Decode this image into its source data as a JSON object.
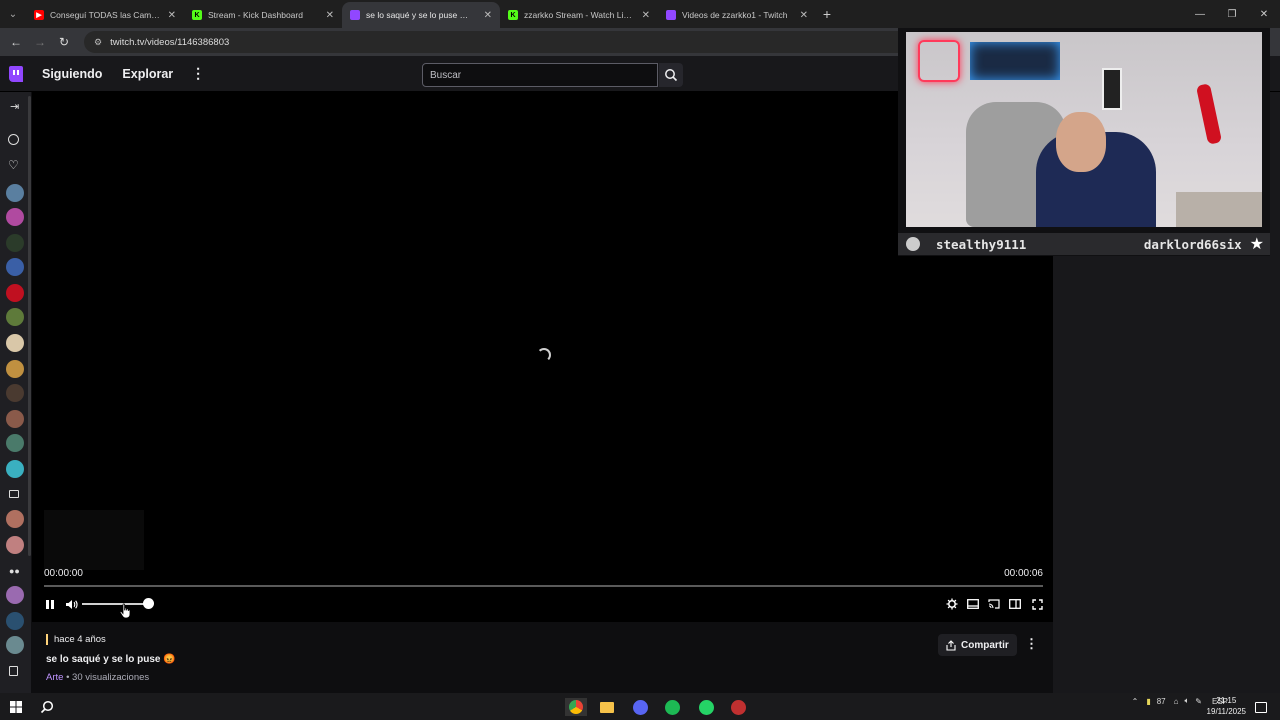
{
  "browser": {
    "tabs": [
      {
        "title": "Conseguí TODAS las Camisetas",
        "favicon": "youtube-icon",
        "color": "#ff0000",
        "active": false
      },
      {
        "title": "Stream - Kick Dashboard",
        "favicon": "kick-icon",
        "color": "#53fc18",
        "active": false
      },
      {
        "title": "se lo saqué y se lo puse 😡 - Twitch",
        "favicon": "twitch-icon",
        "color": "#9147ff",
        "active": true
      },
      {
        "title": "zzarkko Stream - Watch Live on Kick",
        "favicon": "kick-icon",
        "color": "#53fc18",
        "active": false
      },
      {
        "title": "Videos de zzarkko1 - Twitch",
        "favicon": "twitch-icon",
        "color": "#9147ff",
        "active": false
      }
    ],
    "url": "twitch.tv/videos/1146386803"
  },
  "twitch_nav": {
    "following": "Siguiendo",
    "explore": "Explorar",
    "search_placeholder": "Buscar"
  },
  "player": {
    "time_current": "00:00:00",
    "time_total": "00:00:06",
    "progress": 0,
    "volume": 0.92,
    "state": "loading"
  },
  "video_info": {
    "ago": "hace 4 años",
    "title": "se lo saqué y se lo puse 😡",
    "category": "Arte",
    "views": "• 30 visualizaciones",
    "share": "Compartir"
  },
  "webcam": {
    "left_name": "stealthy9111",
    "right_name": "darklord66six"
  },
  "taskbar": {
    "tray_number": "87",
    "lang": "ESP",
    "time": "21:15",
    "date": "19/11/2025"
  },
  "colors": {
    "twitch_purple": "#9147ff",
    "accent_yellow": "#ffd37a",
    "category": "#bf94ff"
  }
}
